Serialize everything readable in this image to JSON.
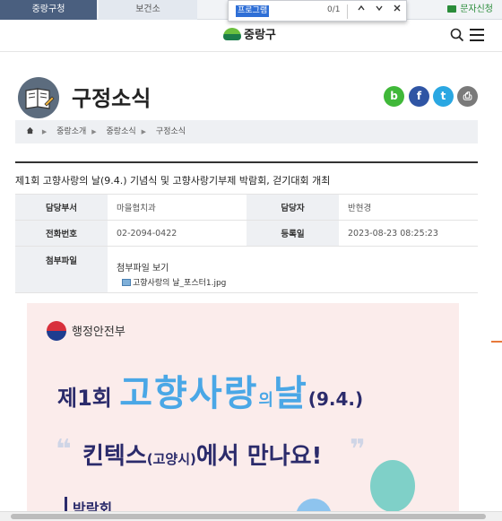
{
  "topbar": {
    "tab_active": "중랑구청",
    "tab_health": "보건소",
    "sms_label": "문자신청"
  },
  "find": {
    "query": "프로그램",
    "count": "0/1"
  },
  "header": {
    "logo_text": "중랑구"
  },
  "page": {
    "title": "구정소식"
  },
  "share": {
    "band": "b",
    "facebook": "f",
    "twitter": "t",
    "print": "⎙"
  },
  "breadcrumb": {
    "items": [
      "중랑소개",
      "중랑소식",
      "구정소식"
    ]
  },
  "post": {
    "title": "제1회 고향사랑의 날(9.4.) 기념식 및 고향사랑기부제 박람회, 걷기대회 개최",
    "meta": {
      "dept_label": "담당부서",
      "dept_value": "마을협치과",
      "manager_label": "담당자",
      "manager_value": "반현경",
      "phone_label": "전화번호",
      "phone_value": "02-2094-0422",
      "date_label": "등록일",
      "date_value": "2023-08-23 08:25:23",
      "attach_label": "첨부파일",
      "attach_view": "첨부파일 보기",
      "attach_file": "고향사랑의 날_포스터1.jpg"
    }
  },
  "poster": {
    "ministry": "행정안전부",
    "headline_prefix": "제1회",
    "headline_main": "고향사랑",
    "headline_particle": "의",
    "headline_day": "날",
    "headline_date": "(9.4.)",
    "subline_main": "킨텍스",
    "subline_small": "(고양시)",
    "subline_rest": "에서 만나요!",
    "quote_open": "❝",
    "quote_close": "❞",
    "fair_tag": "박람회"
  }
}
